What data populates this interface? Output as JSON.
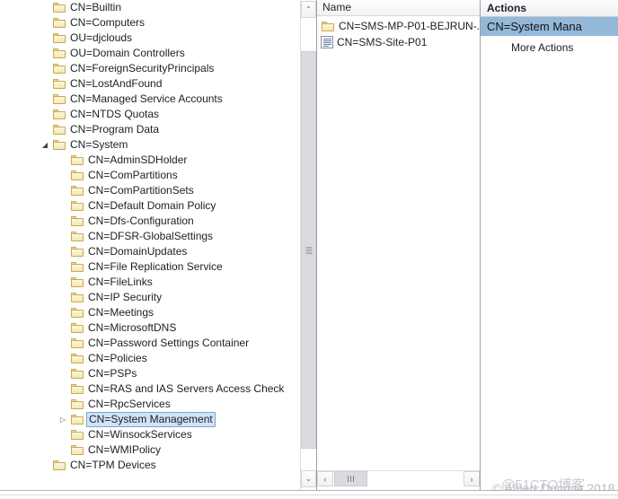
{
  "tree": {
    "rows": [
      {
        "label": "CN=Builtin",
        "depth": 1,
        "expander": "none",
        "icon": "folder-icon",
        "selected": false
      },
      {
        "label": "CN=Computers",
        "depth": 1,
        "expander": "none",
        "icon": "folder-icon",
        "selected": false
      },
      {
        "label": "OU=djclouds",
        "depth": 1,
        "expander": "none",
        "icon": "folder-icon",
        "selected": false
      },
      {
        "label": "OU=Domain Controllers",
        "depth": 1,
        "expander": "none",
        "icon": "folder-icon",
        "selected": false
      },
      {
        "label": "CN=ForeignSecurityPrincipals",
        "depth": 1,
        "expander": "none",
        "icon": "folder-icon",
        "selected": false
      },
      {
        "label": "CN=LostAndFound",
        "depth": 1,
        "expander": "none",
        "icon": "folder-icon",
        "selected": false
      },
      {
        "label": "CN=Managed Service Accounts",
        "depth": 1,
        "expander": "none",
        "icon": "folder-icon",
        "selected": false
      },
      {
        "label": "CN=NTDS Quotas",
        "depth": 1,
        "expander": "none",
        "icon": "folder-icon",
        "selected": false
      },
      {
        "label": "CN=Program Data",
        "depth": 1,
        "expander": "none",
        "icon": "folder-icon",
        "selected": false
      },
      {
        "label": "CN=System",
        "depth": 1,
        "expander": "expanded",
        "icon": "folder-icon",
        "selected": false
      },
      {
        "label": "CN=AdminSDHolder",
        "depth": 2,
        "expander": "none",
        "icon": "folder-icon",
        "selected": false
      },
      {
        "label": "CN=ComPartitions",
        "depth": 2,
        "expander": "none",
        "icon": "folder-icon",
        "selected": false
      },
      {
        "label": "CN=ComPartitionSets",
        "depth": 2,
        "expander": "none",
        "icon": "folder-icon",
        "selected": false
      },
      {
        "label": "CN=Default Domain Policy",
        "depth": 2,
        "expander": "none",
        "icon": "folder-icon",
        "selected": false
      },
      {
        "label": "CN=Dfs-Configuration",
        "depth": 2,
        "expander": "none",
        "icon": "folder-icon",
        "selected": false
      },
      {
        "label": "CN=DFSR-GlobalSettings",
        "depth": 2,
        "expander": "none",
        "icon": "folder-icon",
        "selected": false
      },
      {
        "label": "CN=DomainUpdates",
        "depth": 2,
        "expander": "none",
        "icon": "folder-icon",
        "selected": false
      },
      {
        "label": "CN=File Replication Service",
        "depth": 2,
        "expander": "none",
        "icon": "folder-icon",
        "selected": false
      },
      {
        "label": "CN=FileLinks",
        "depth": 2,
        "expander": "none",
        "icon": "folder-icon",
        "selected": false
      },
      {
        "label": "CN=IP Security",
        "depth": 2,
        "expander": "none",
        "icon": "folder-icon",
        "selected": false
      },
      {
        "label": "CN=Meetings",
        "depth": 2,
        "expander": "none",
        "icon": "folder-icon",
        "selected": false
      },
      {
        "label": "CN=MicrosoftDNS",
        "depth": 2,
        "expander": "none",
        "icon": "folder-icon",
        "selected": false
      },
      {
        "label": "CN=Password Settings Container",
        "depth": 2,
        "expander": "none",
        "icon": "folder-icon",
        "selected": false
      },
      {
        "label": "CN=Policies",
        "depth": 2,
        "expander": "none",
        "icon": "folder-icon",
        "selected": false
      },
      {
        "label": "CN=PSPs",
        "depth": 2,
        "expander": "none",
        "icon": "folder-icon",
        "selected": false
      },
      {
        "label": "CN=RAS and IAS Servers Access Check",
        "depth": 2,
        "expander": "none",
        "icon": "folder-icon",
        "selected": false
      },
      {
        "label": "CN=RpcServices",
        "depth": 2,
        "expander": "none",
        "icon": "folder-icon",
        "selected": false
      },
      {
        "label": "CN=System Management",
        "depth": 2,
        "expander": "collapsed",
        "icon": "folder-icon",
        "selected": true
      },
      {
        "label": "CN=WinsockServices",
        "depth": 2,
        "expander": "none",
        "icon": "folder-icon",
        "selected": false
      },
      {
        "label": "CN=WMIPolicy",
        "depth": 2,
        "expander": "none",
        "icon": "folder-icon",
        "selected": false
      },
      {
        "label": "CN=TPM Devices",
        "depth": 1,
        "expander": "none",
        "icon": "folder-icon",
        "selected": false
      }
    ],
    "glyphs": {
      "collapsed": "▷",
      "expanded": "◢"
    },
    "scrollbar": {
      "up_arrow": "⌃",
      "down_arrow": "⌄"
    }
  },
  "list": {
    "columns": [
      "Name"
    ],
    "rows": [
      {
        "label": "CN=SMS-MP-P01-BEJRUN-..",
        "icon": "folder-icon"
      },
      {
        "label": "CN=SMS-Site-P01",
        "icon": "document-icon"
      }
    ],
    "hscroll": {
      "left_arrow": "‹",
      "right_arrow": "›"
    }
  },
  "actions": {
    "title": "Actions",
    "selected_item": "CN=System Mana",
    "more_actions": "More Actions",
    "highlight_color": "#93b8d8"
  },
  "watermarks": {
    "site": "@51CTO博客",
    "author": "© Albert Dongjie 2018"
  }
}
